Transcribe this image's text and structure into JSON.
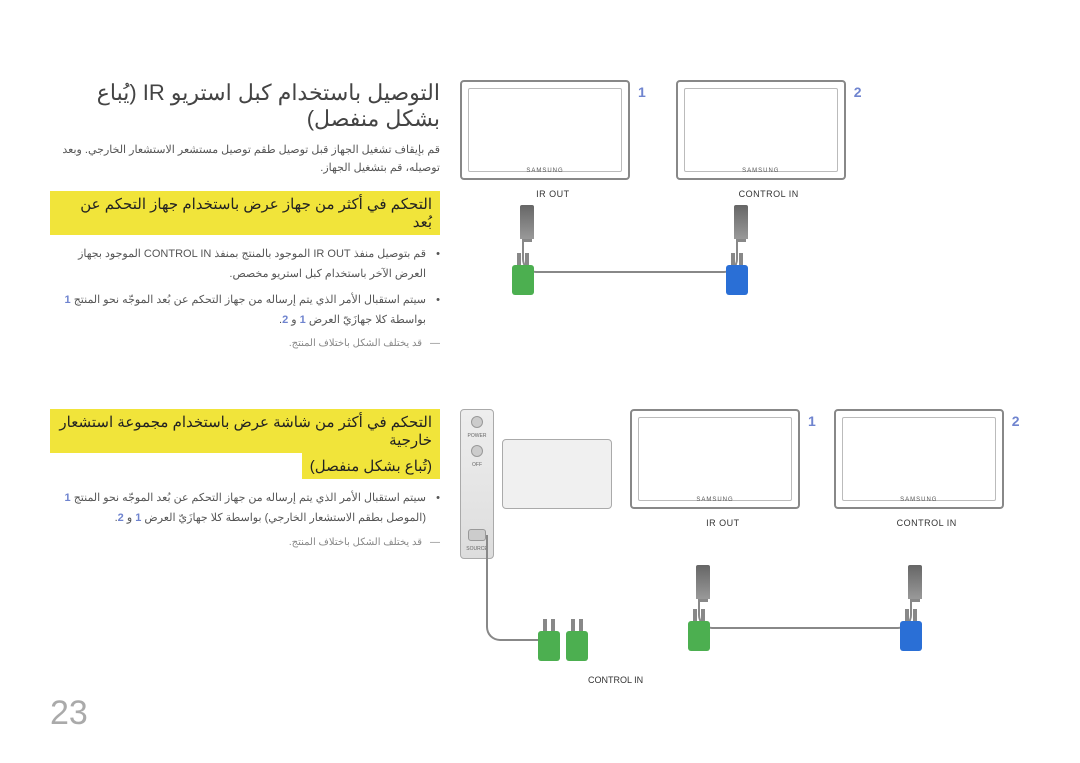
{
  "title_main": "التوصيل باستخدام كبل استريو IR (يُباع بشكل منفصل)",
  "sub_instruction": "قم بإيقاف تشغيل الجهاز قبل توصيل طقم توصيل مستشعر الاستشعار الخارجي. وبعد توصيله، قم بتشغيل الجهاز.",
  "h2_a": "التحكم في أكثر من جهاز عرض باستخدام جهاز التحكم عن بُعد",
  "bullets_a": [
    "قم بتوصيل منفذ IR OUT الموجود بالمنتج بمنفذ CONTROL IN الموجود بجهاز العرض الآخر باستخدام كبل استريو مخصص.",
    "سيتم استقبال الأمر الذي يتم إرساله من جهاز التحكم عن بُعد الموجّه نحو المنتج"
  ],
  "bullet_a_tail": "بواسطة كلا جهازَيّ العرض",
  "and": "و",
  "note_text": "قد يختلف الشكل باختلاف المنتج.",
  "h2_b": "التحكم في أكثر من شاشة عرض باستخدام مجموعة استشعار خارجية",
  "h2_b_sub": "(تُباع بشكل منفصل)",
  "bullets_b": [
    "سيتم استقبال الأمر الذي يتم إرساله من جهاز التحكم عن بُعد الموجّه نحو المنتج"
  ],
  "bullet_b_tail_pre": "(الموصل بطقم الاستشعار الخارجي) بواسطة كلا جهازَيّ العرض",
  "labels": {
    "ir_out": "IR OUT",
    "control_in": "CONTROL IN",
    "brand": "SAMSUNG",
    "num1": "1",
    "num2": "2",
    "dot": "."
  },
  "remote_labels": {
    "power": "POWER",
    "off": "OFF",
    "source": "SOURCE"
  },
  "page_number": "23"
}
